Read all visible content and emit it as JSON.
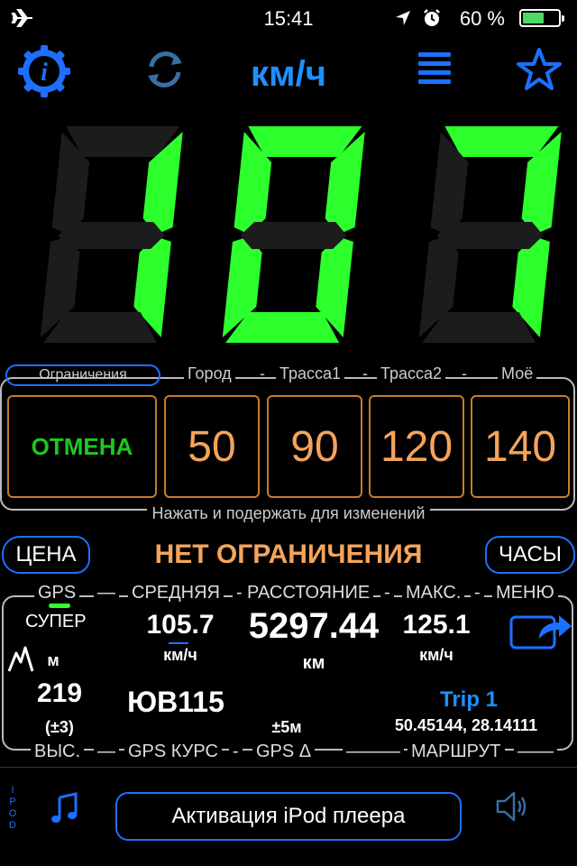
{
  "status_bar": {
    "time": "15:41",
    "battery_percent": "60 %",
    "battery_level": 0.6
  },
  "toolbar": {
    "unit": "км/ч",
    "icons": [
      "info-gear-icon",
      "refresh-icon",
      "menu-icon",
      "star-icon"
    ],
    "accent": "#1e90ff"
  },
  "speed": {
    "value": "107",
    "digit_color": "#2dff2d",
    "inactive_color": "#1c1c1c"
  },
  "limits": {
    "tab_label": "Ограничения",
    "headers": [
      "Город",
      "Трасса1",
      "Трасса2",
      "Моё"
    ],
    "cancel_label": "ОТМЕНА",
    "values": [
      "50",
      "90",
      "120",
      "140"
    ],
    "hint": "Нажать и подержать для изменений"
  },
  "price_row": {
    "price_label": "ЦЕНА",
    "status": "НЕТ ОГРАНИЧЕНИЯ",
    "clock_label": "ЧАСЫ"
  },
  "stats": {
    "gps_label": "GPS",
    "gps_quality": "СУПЕР",
    "avg_label": "СРЕДНЯЯ",
    "avg_value": "105.7",
    "avg_unit": "км/ч",
    "distance_label": "РАССТОЯНИЕ",
    "distance_value": "5297.44",
    "distance_unit": "км",
    "max_label": "МАКС.",
    "max_value": "125.1",
    "max_unit": "км/ч",
    "menu_label": "МЕНЮ",
    "alt_unit": "м",
    "alt_value": "219",
    "alt_accuracy": "(±3)",
    "alt_label": "ВЫС.",
    "course_value": "ЮВ115",
    "course_label": "GPS КУРС",
    "gps_delta_value": "±5м",
    "gps_delta_label": "GPS Δ",
    "trip_name": "Trip 1",
    "coordinates": "50.45144, 28.14111",
    "route_label": "МАРШРУТ"
  },
  "ipod": {
    "vertical_label": "IPOD",
    "activate_label": "Активация iPod плеера"
  }
}
